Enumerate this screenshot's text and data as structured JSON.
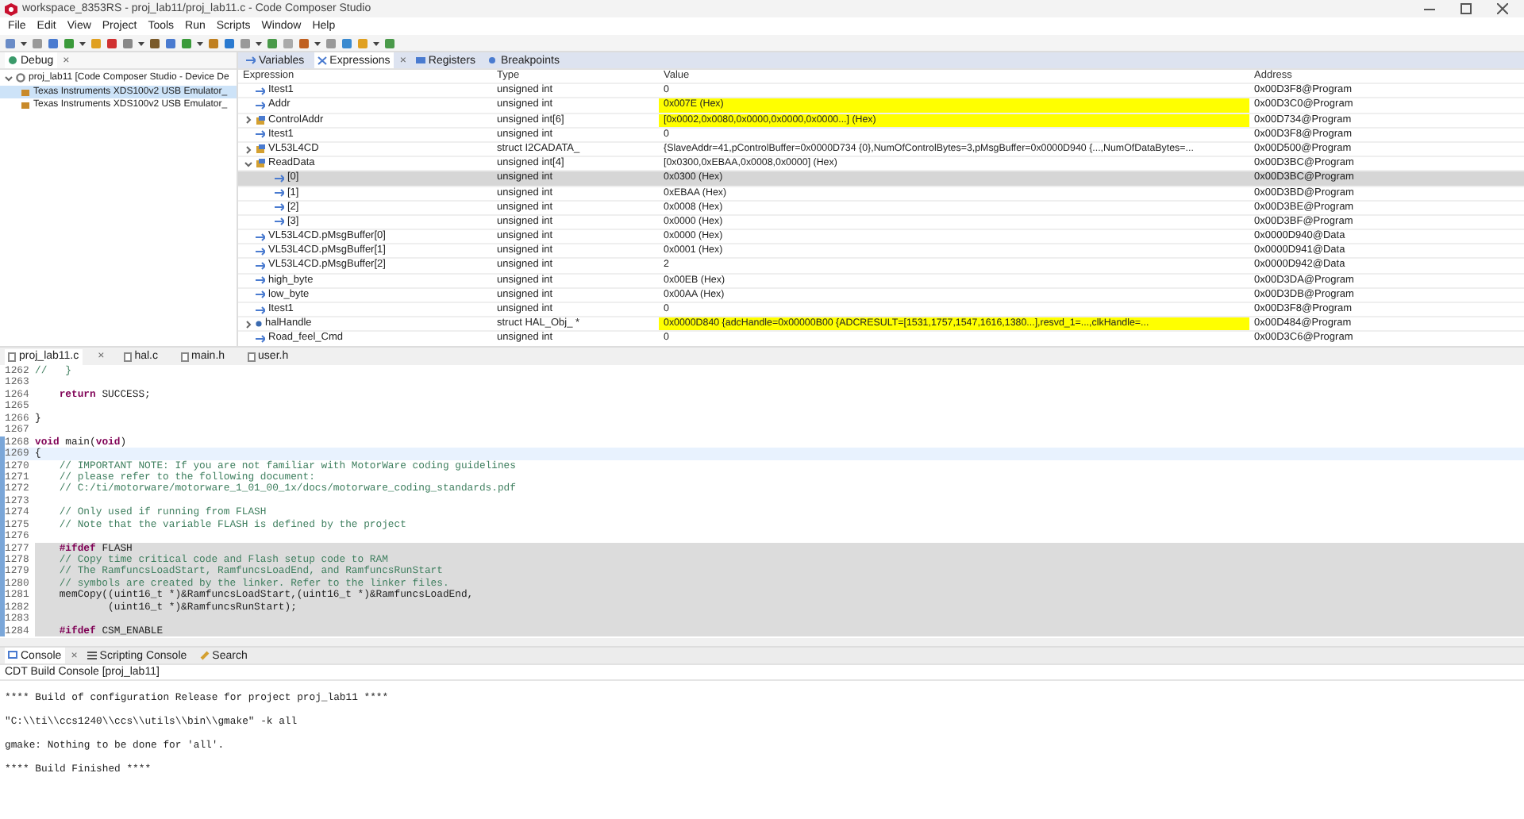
{
  "window": {
    "title": "workspace_8353RS - proj_lab11/proj_lab11.c - Code Composer Studio"
  },
  "menu": [
    "File",
    "Edit",
    "View",
    "Project",
    "Tools",
    "Run",
    "Scripts",
    "Window",
    "Help"
  ],
  "debug_view": {
    "tab": "Debug",
    "close": "×",
    "tree": [
      {
        "label": "proj_lab11 [Code Composer Studio - Device De",
        "expanded": true,
        "selected": false,
        "children": [
          {
            "label": "Texas Instruments XDS100v2 USB Emulator_",
            "selected": true
          },
          {
            "label": "Texas Instruments XDS100v2 USB Emulator_",
            "selected": false
          }
        ]
      }
    ]
  },
  "expressions_view": {
    "tabs": [
      {
        "label": "Variables",
        "selected": false
      },
      {
        "label": "Expressions",
        "selected": true,
        "close": "×"
      },
      {
        "label": "Registers",
        "selected": false
      },
      {
        "label": "Breakpoints",
        "selected": false
      }
    ],
    "columns": [
      "Expression",
      "Type",
      "Value",
      "Address"
    ],
    "rows": [
      {
        "kind": "variable",
        "name": "Itest1",
        "type": "unsigned int",
        "value": "0",
        "address": "0x00D3F8@Program",
        "changed": false,
        "selected": false
      },
      {
        "kind": "variable",
        "name": "Addr",
        "type": "unsigned int",
        "value": "0x007E (Hex)",
        "address": "0x00D3C0@Program",
        "changed": true,
        "selected": false
      },
      {
        "kind": "array",
        "expanded": false,
        "name": "ControlAddr",
        "type": "unsigned int[6]",
        "value": "[0x0002,0x0080,0x0000,0x0000,0x0000...] (Hex)",
        "address": "0x00D734@Program",
        "changed": true,
        "selected": false
      },
      {
        "kind": "variable",
        "name": "Itest1",
        "type": "unsigned int",
        "value": "0",
        "address": "0x00D3F8@Program",
        "changed": false,
        "selected": false
      },
      {
        "kind": "array",
        "expanded": false,
        "name": "VL53L4CD",
        "type": "struct I2CADATA_",
        "value": "{SlaveAddr=41,pControlBuffer=0x0000D734 {0},NumOfControlBytes=3,pMsgBuffer=0x0000D940 {...,NumOfDataBytes=...",
        "address": "0x00D500@Program",
        "changed": false,
        "selected": false
      },
      {
        "kind": "array",
        "expanded": true,
        "name": "ReadData",
        "type": "unsigned int[4]",
        "value": "[0x0300,0xEBAA,0x0008,0x0000] (Hex)",
        "address": "0x00D3BC@Program",
        "changed": false,
        "selected": false,
        "children": [
          {
            "kind": "variable",
            "name": "[0]",
            "type": "unsigned int",
            "value": "0x0300 (Hex)",
            "address": "0x00D3BC@Program",
            "changed": false,
            "selected": true
          },
          {
            "kind": "variable",
            "name": "[1]",
            "type": "unsigned int",
            "value": "0xEBAA (Hex)",
            "address": "0x00D3BD@Program",
            "changed": false,
            "selected": false
          },
          {
            "kind": "variable",
            "name": "[2]",
            "type": "unsigned int",
            "value": "0x0008 (Hex)",
            "address": "0x00D3BE@Program",
            "changed": false,
            "selected": false
          },
          {
            "kind": "variable",
            "name": "[3]",
            "type": "unsigned int",
            "value": "0x0000 (Hex)",
            "address": "0x00D3BF@Program",
            "changed": false,
            "selected": false
          }
        ]
      },
      {
        "kind": "variable",
        "name": "VL53L4CD.pMsgBuffer[0]",
        "type": "unsigned int",
        "value": "0x0000 (Hex)",
        "address": "0x0000D940@Data",
        "changed": false,
        "selected": false
      },
      {
        "kind": "variable",
        "name": "VL53L4CD.pMsgBuffer[1]",
        "type": "unsigned int",
        "value": "0x0001 (Hex)",
        "address": "0x0000D941@Data",
        "changed": false,
        "selected": false
      },
      {
        "kind": "variable",
        "name": "VL53L4CD.pMsgBuffer[2]",
        "type": "unsigned int",
        "value": "2",
        "address": "0x0000D942@Data",
        "changed": false,
        "selected": false
      },
      {
        "kind": "variable",
        "name": "high_byte",
        "type": "unsigned int",
        "value": "0x00EB (Hex)",
        "address": "0x00D3DA@Program",
        "changed": false,
        "selected": false
      },
      {
        "kind": "variable",
        "name": "low_byte",
        "type": "unsigned int",
        "value": "0x00AA (Hex)",
        "address": "0x00D3DB@Program",
        "changed": false,
        "selected": false
      },
      {
        "kind": "variable",
        "name": "Itest1",
        "type": "unsigned int",
        "value": "0",
        "address": "0x00D3F8@Program",
        "changed": false,
        "selected": false
      },
      {
        "kind": "pointer",
        "expanded": false,
        "name": "halHandle",
        "type": "struct HAL_Obj_ *",
        "value": "0x0000D840 {adcHandle=0x00000B00 {ADCRESULT=[1531,1757,1547,1616,1380...],resvd_1=...,clkHandle=...",
        "address": "0x00D484@Program",
        "changed": true,
        "selected": false
      },
      {
        "kind": "variable",
        "name": "Road_feel_Cmd",
        "type": "unsigned int",
        "value": "0",
        "address": "0x00D3C6@Program",
        "changed": false,
        "selected": false
      }
    ]
  },
  "editor": {
    "tabs": [
      {
        "label": "proj_lab11.c",
        "selected": true,
        "close": "×"
      },
      {
        "label": "hal.c",
        "selected": false
      },
      {
        "label": "main.h",
        "selected": false
      },
      {
        "label": "user.h",
        "selected": false
      }
    ],
    "lines": [
      {
        "number": "1262",
        "segments": [
          {
            "kind": "comment",
            "text": "//   }"
          }
        ]
      },
      {
        "number": "1263"
      },
      {
        "number": "1264",
        "segments": [
          {
            "kind": "keyword",
            "text": "    return"
          },
          {
            "kind": "plain",
            "text": " SUCCESS;"
          }
        ]
      },
      {
        "number": "1265"
      },
      {
        "number": "1266",
        "segments": [
          {
            "kind": "plain",
            "text": "}"
          }
        ]
      },
      {
        "number": "1267"
      },
      {
        "number": "1268",
        "marked": true,
        "segments": [
          {
            "kind": "keyword",
            "text": "void"
          },
          {
            "kind": "plain",
            "text": " main("
          },
          {
            "kind": "keyword",
            "text": "void"
          },
          {
            "kind": "plain",
            "text": ")"
          }
        ]
      },
      {
        "number": "1269",
        "marked": true,
        "current": true,
        "segments": [
          {
            "kind": "plain",
            "text": "{"
          }
        ]
      },
      {
        "number": "1270",
        "marked": true,
        "segments": [
          {
            "kind": "comment",
            "text": "    // IMPORTANT NOTE: If you are not familiar with MotorWare coding guidelines"
          }
        ]
      },
      {
        "number": "1271",
        "marked": true,
        "segments": [
          {
            "kind": "comment",
            "text": "    // please refer to the following document:"
          }
        ]
      },
      {
        "number": "1272",
        "marked": true,
        "segments": [
          {
            "kind": "comment",
            "text": "    // C:/ti/motorware/motorware_1_01_00_1x/docs/motorware_coding_standards.pdf"
          }
        ]
      },
      {
        "number": "1273",
        "marked": true
      },
      {
        "number": "1274",
        "marked": true,
        "segments": [
          {
            "kind": "comment",
            "text": "    // Only used if running from FLASH"
          }
        ]
      },
      {
        "number": "1275",
        "marked": true,
        "segments": [
          {
            "kind": "comment",
            "text": "    // Note that the variable FLASH is defined by the project"
          }
        ]
      },
      {
        "number": "1276",
        "marked": true
      },
      {
        "number": "1277",
        "marked": true,
        "inactive": true,
        "segments": [
          {
            "kind": "keyword",
            "text": "    #ifdef"
          },
          {
            "kind": "plain",
            "text": " FLASH"
          }
        ]
      },
      {
        "number": "1278",
        "marked": true,
        "inactive": true,
        "segments": [
          {
            "kind": "comment",
            "text": "    // Copy time critical code and Flash setup code to RAM"
          }
        ]
      },
      {
        "number": "1279",
        "marked": true,
        "inactive": true,
        "segments": [
          {
            "kind": "comment",
            "text": "    // The RamfuncsLoadStart, RamfuncsLoadEnd, and RamfuncsRunStart"
          }
        ]
      },
      {
        "number": "1280",
        "marked": true,
        "inactive": true,
        "segments": [
          {
            "kind": "comment",
            "text": "    // symbols are created by the linker. Refer to the linker files."
          }
        ]
      },
      {
        "number": "1281",
        "marked": true,
        "inactive": true,
        "segments": [
          {
            "kind": "plain",
            "text": "    memCopy((uint16_t *)&RamfuncsLoadStart,(uint16_t *)&RamfuncsLoadEnd,"
          }
        ]
      },
      {
        "number": "1282",
        "marked": true,
        "inactive": true,
        "segments": [
          {
            "kind": "plain",
            "text": "            (uint16_t *)&RamfuncsRunStart);"
          }
        ]
      },
      {
        "number": "1283",
        "marked": true,
        "inactive": true
      },
      {
        "number": "1284",
        "marked": true,
        "inactive": true,
        "segments": [
          {
            "kind": "keyword",
            "text": "    #ifdef"
          },
          {
            "kind": "plain",
            "text": " CSM_ENABLE"
          }
        ]
      }
    ]
  },
  "console": {
    "tabs": [
      {
        "label": "Console",
        "selected": true,
        "close": "×"
      },
      {
        "label": "Scripting Console",
        "selected": false
      },
      {
        "label": "Search",
        "selected": false
      }
    ],
    "subtitle": "CDT Build Console [proj_lab11]",
    "lines": [
      "**** Build of configuration Release for project proj_lab11 ****",
      "\"C:\\\\ti\\\\ccs1240\\\\ccs\\\\utils\\\\bin\\\\gmake\" -k all",
      "gmake: Nothing to be done for 'all'.",
      "**** Build Finished ****"
    ]
  }
}
